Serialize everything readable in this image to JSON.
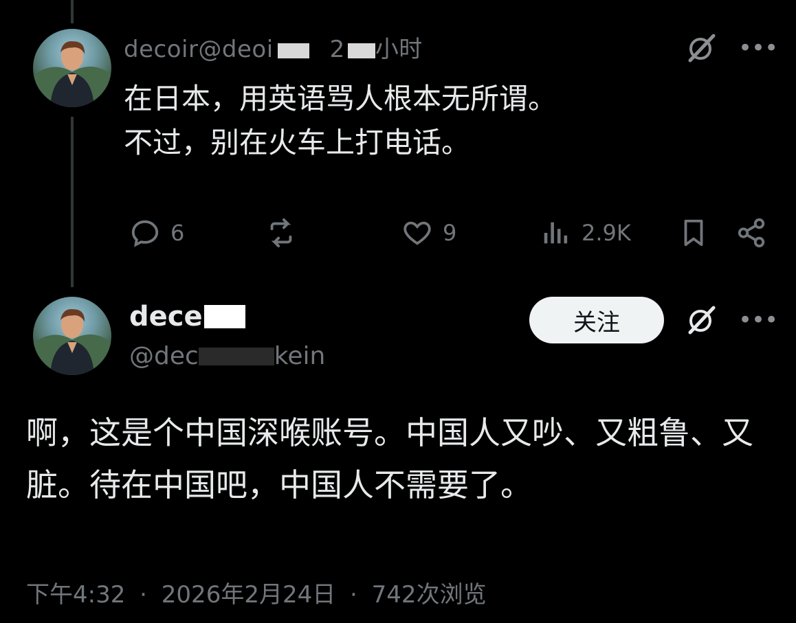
{
  "post1": {
    "handle_partial": "decoir@deoi",
    "time_partial": "小时",
    "text": "在日本，用英语骂人根本无所谓。\n不过，别在火车上打电话。",
    "actions": {
      "reply_count": "6",
      "like_count": "9",
      "view_count": "2.9K"
    }
  },
  "post2": {
    "display_name_partial": "dece",
    "handle_partial": "@dec",
    "handle_suffix": "kein",
    "follow_label": "关注",
    "text": "啊，这是个中国深喉账号。中国人又吵、又粗鲁、又脏。待在中国吧，中国人不需要了。",
    "time": "下午4:32",
    "date": "2026年2月24日",
    "views": "742次浏览",
    "separator": "·"
  },
  "colors": {
    "background": "#000000",
    "text_primary": "#e7e9ea",
    "text_secondary": "#71767b",
    "thread_line": "#333639",
    "follow_bg": "#eff3f4"
  },
  "icons": [
    "reply-icon",
    "retweet-icon",
    "like-icon",
    "views-icon",
    "bookmark-icon",
    "share-icon",
    "grok-icon",
    "more-icon"
  ]
}
